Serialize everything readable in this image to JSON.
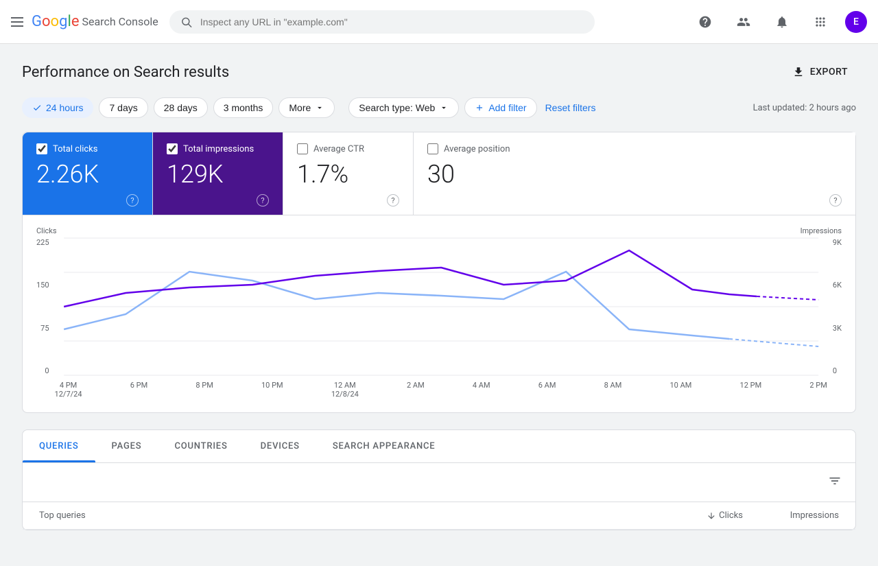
{
  "app": {
    "title": "Google Search Console",
    "logo_google": "Google",
    "logo_product": "Search Console"
  },
  "header": {
    "search_placeholder": "Inspect any URL in \"example.com\"",
    "avatar_letter": "E",
    "export_label": "EXPORT"
  },
  "page": {
    "title": "Performance on Search results",
    "last_updated": "Last updated: 2 hours ago"
  },
  "filters": {
    "time_options": [
      {
        "label": "24 hours",
        "active": true
      },
      {
        "label": "7 days",
        "active": false
      },
      {
        "label": "28 days",
        "active": false
      },
      {
        "label": "3 months",
        "active": false
      },
      {
        "label": "More",
        "active": false,
        "has_arrow": true
      }
    ],
    "search_type_label": "Search type: Web",
    "add_filter_label": "Add filter",
    "reset_filters_label": "Reset filters"
  },
  "metrics": [
    {
      "label": "Total clicks",
      "value": "2.26K",
      "checked": true,
      "theme": "blue"
    },
    {
      "label": "Total impressions",
      "value": "129K",
      "checked": true,
      "theme": "purple"
    },
    {
      "label": "Average CTR",
      "value": "1.7%",
      "checked": false,
      "theme": "light"
    },
    {
      "label": "Average position",
      "value": "30",
      "checked": false,
      "theme": "light"
    }
  ],
  "chart": {
    "y_left_label": "Clicks",
    "y_right_label": "Impressions",
    "y_left_ticks": [
      "225",
      "150",
      "75",
      "0"
    ],
    "y_right_ticks": [
      "9K",
      "6K",
      "3K",
      "0"
    ],
    "x_ticks": [
      {
        "time": "4 PM",
        "date": "12/7/24"
      },
      {
        "time": "6 PM",
        "date": ""
      },
      {
        "time": "8 PM",
        "date": ""
      },
      {
        "time": "10 PM",
        "date": ""
      },
      {
        "time": "12 AM",
        "date": "12/8/24"
      },
      {
        "time": "2 AM",
        "date": ""
      },
      {
        "time": "4 AM",
        "date": ""
      },
      {
        "time": "6 AM",
        "date": ""
      },
      {
        "time": "8 AM",
        "date": ""
      },
      {
        "time": "10 AM",
        "date": ""
      },
      {
        "time": "12 PM",
        "date": ""
      },
      {
        "time": "2 PM",
        "date": ""
      }
    ]
  },
  "tabs": {
    "items": [
      {
        "label": "QUERIES",
        "active": true
      },
      {
        "label": "PAGES",
        "active": false
      },
      {
        "label": "COUNTRIES",
        "active": false
      },
      {
        "label": "DEVICES",
        "active": false
      },
      {
        "label": "SEARCH APPEARANCE",
        "active": false
      }
    ]
  },
  "table": {
    "col_query": "Top queries",
    "col_clicks": "Clicks",
    "col_impressions": "Impressions"
  },
  "icons": {
    "menu": "☰",
    "search": "🔍",
    "help": "?",
    "account": "👤",
    "bell": "🔔",
    "apps": "⋮⋮",
    "download": "↓",
    "check": "✓",
    "plus": "+",
    "chevron_down": "▾",
    "sort_down": "↓",
    "filter_list": "≡"
  }
}
